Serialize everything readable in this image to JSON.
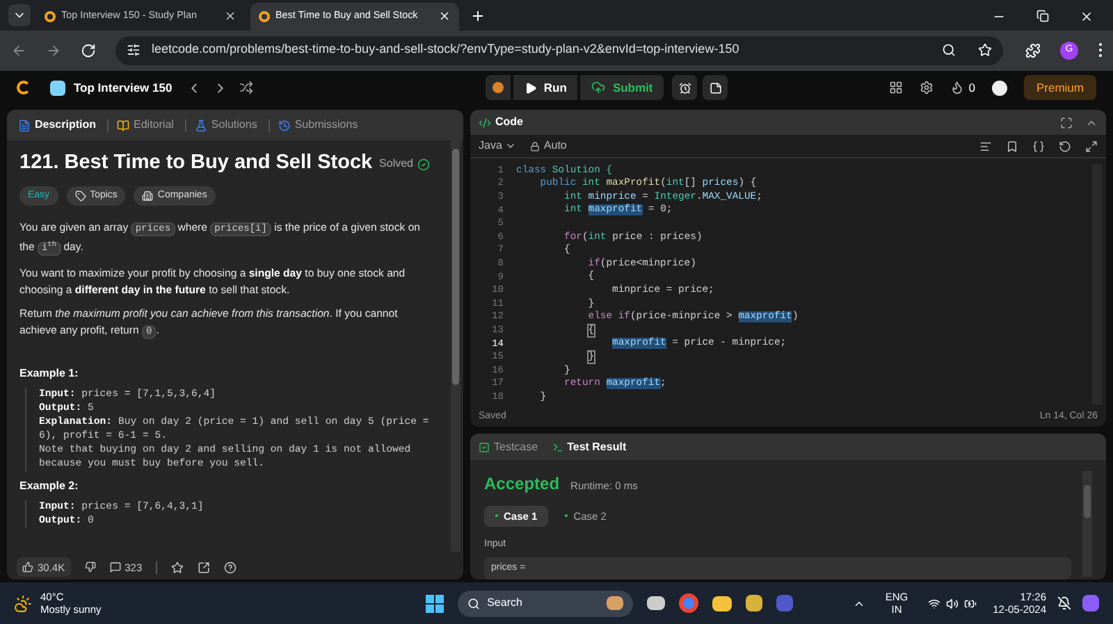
{
  "browser": {
    "tabs": [
      {
        "title": "Top Interview 150 - Study Plan",
        "selected": false
      },
      {
        "title": "Best Time to Buy and Sell Stock",
        "selected": true
      }
    ],
    "url": "leetcode.com/problems/best-time-to-buy-and-sell-stock/?envType=study-plan-v2&envId=top-interview-150",
    "profile": "G"
  },
  "navbar": {
    "study_plan": "Top Interview 150",
    "run": "Run",
    "submit": "Submit",
    "streak": "0",
    "premium": "Premium"
  },
  "description_panel": {
    "tabs": [
      {
        "label": "Description",
        "selected": true
      },
      {
        "label": "Editorial",
        "selected": false
      },
      {
        "label": "Solutions",
        "selected": false
      },
      {
        "label": "Submissions",
        "selected": false
      }
    ],
    "title": "121. Best Time to Buy and Sell Stock",
    "status": "Solved",
    "tags": [
      {
        "label": "Easy",
        "kind": "difficulty"
      },
      {
        "label": "Topics",
        "kind": "topics"
      },
      {
        "label": "Companies",
        "kind": "companies"
      }
    ],
    "paragraphs": [
      [
        {
          "text": "You are given an array ",
          "kind": "text"
        },
        {
          "text": "prices",
          "kind": "code"
        },
        {
          "text": " where ",
          "kind": "text"
        },
        {
          "text": "prices[i]",
          "kind": "code"
        },
        {
          "text": " is the price of a given stock on the ",
          "kind": "text"
        },
        {
          "text": "i$^{th}$",
          "kind": "code"
        },
        {
          "text": " day.",
          "kind": "text"
        }
      ],
      [
        {
          "text": "You want to maximize your profit by choosing a ",
          "kind": "text"
        },
        {
          "text": "single day",
          "kind": "bold"
        },
        {
          "text": " to buy one stock and choosing a ",
          "kind": "text"
        },
        {
          "text": "different day in the future",
          "kind": "bold"
        },
        {
          "text": " to sell that stock.",
          "kind": "text"
        }
      ],
      [
        {
          "text": "Return ",
          "kind": "text"
        },
        {
          "text": "the maximum profit you can achieve from this transaction",
          "kind": "italic"
        },
        {
          "text": ". If you cannot achieve any profit, return ",
          "kind": "text"
        },
        {
          "text": "0",
          "kind": "code"
        },
        {
          "text": ".",
          "kind": "text"
        }
      ]
    ],
    "examples": [
      {
        "title": "Example 1:",
        "lines": [
          {
            "label": "Input:",
            "text": "prices = [7,1,5,3,6,4]"
          },
          {
            "label": "Output:",
            "text": "5"
          },
          {
            "label": "Explanation:",
            "text": "Buy on day 2 (price = 1) and sell on day 5 (price = 6), profit = 6-1 = 5."
          },
          {
            "text": "Note that buying on day 2 and selling on day 1 is not allowed because you must buy before you sell."
          }
        ]
      },
      {
        "title": "Example 2:",
        "lines": [
          {
            "label": "Input:",
            "text": "prices = [7,6,4,3,1]"
          },
          {
            "label": "Output:",
            "text": "0"
          }
        ]
      }
    ],
    "likes": "30.4K",
    "comments": "323"
  },
  "code_panel": {
    "title": "Code",
    "language": "Java",
    "mode": "Auto",
    "lines": [
      {
        "number": "1",
        "current": false,
        "tokens": [
          {
            "text": "class ",
            "kind": "keyword"
          },
          {
            "text": "Solution {",
            "kind": "class"
          }
        ]
      },
      {
        "number": "2",
        "current": false,
        "tokens": [
          {
            "text": "    public ",
            "kind": "keyword"
          },
          {
            "text": "int ",
            "kind": "type"
          },
          {
            "text": "maxProfit",
            "kind": "function"
          },
          {
            "text": "(",
            "kind": "plain"
          },
          {
            "text": "int",
            "kind": "type"
          },
          {
            "text": "[] ",
            "kind": "plain"
          },
          {
            "text": "prices",
            "kind": "variable"
          },
          {
            "text": ") {",
            "kind": "plain"
          }
        ]
      },
      {
        "number": "3",
        "current": false,
        "tokens": [
          {
            "text": "        int ",
            "kind": "type"
          },
          {
            "text": "minprice",
            "kind": "variable"
          },
          {
            "text": " = ",
            "kind": "plain"
          },
          {
            "text": "Integer",
            "kind": "class"
          },
          {
            "text": ".",
            "kind": "plain"
          },
          {
            "text": "MAX_VALUE",
            "kind": "variable"
          },
          {
            "text": ";",
            "kind": "plain"
          }
        ]
      },
      {
        "number": "4",
        "current": false,
        "tokens": [
          {
            "text": "        int ",
            "kind": "type"
          },
          {
            "text": "maxprofit",
            "kind": "highlight"
          },
          {
            "text": " = 0;",
            "kind": "plain"
          }
        ]
      },
      {
        "number": "5",
        "current": false
      },
      {
        "number": "6",
        "current": false,
        "tokens": [
          {
            "text": "        for",
            "kind": "control"
          },
          {
            "text": "(",
            "kind": "plain"
          },
          {
            "text": "int ",
            "kind": "type"
          },
          {
            "text": "price : prices)",
            "kind": "plain"
          }
        ]
      },
      {
        "number": "7",
        "current": false,
        "tokens": [
          {
            "text": "        {",
            "kind": "plain"
          }
        ]
      },
      {
        "number": "8",
        "current": false,
        "tokens": [
          {
            "text": "            if",
            "kind": "control"
          },
          {
            "text": "(price<minprice)",
            "kind": "plain"
          }
        ]
      },
      {
        "number": "9",
        "current": false,
        "tokens": [
          {
            "text": "            {",
            "kind": "plain"
          }
        ]
      },
      {
        "number": "10",
        "current": false,
        "tokens": [
          {
            "text": "                minprice = price;",
            "kind": "plain"
          }
        ]
      },
      {
        "number": "11",
        "current": false,
        "tokens": [
          {
            "text": "            }",
            "kind": "plain"
          }
        ]
      },
      {
        "number": "12",
        "current": false,
        "tokens": [
          {
            "text": "            else if",
            "kind": "control"
          },
          {
            "text": "(price-minprice > ",
            "kind": "plain"
          },
          {
            "text": "maxprofit",
            "kind": "highlight"
          },
          {
            "text": ")",
            "kind": "plain"
          }
        ]
      },
      {
        "number": "13",
        "current": false,
        "tokens": [
          {
            "text": "            {",
            "kind": "match"
          }
        ]
      },
      {
        "number": "14",
        "current": true,
        "tokens": [
          {
            "text": "                maxprofit",
            "kind": "highlight"
          },
          {
            "text": " = price - minprice;",
            "kind": "plain"
          }
        ]
      },
      {
        "number": "15",
        "current": false,
        "tokens": [
          {
            "text": "            }",
            "kind": "match"
          }
        ]
      },
      {
        "number": "16",
        "current": false,
        "tokens": [
          {
            "text": "        }",
            "kind": "plain"
          }
        ]
      },
      {
        "number": "17",
        "current": false,
        "tokens": [
          {
            "text": "        return ",
            "kind": "control"
          },
          {
            "text": "maxprofit",
            "kind": "highlight"
          },
          {
            "text": ";",
            "kind": "plain"
          }
        ]
      },
      {
        "number": "18",
        "current": false,
        "tokens": [
          {
            "text": "    }",
            "kind": "plain"
          }
        ]
      }
    ],
    "save_status": "Saved",
    "cursor": "Ln 14, Col 26"
  },
  "result_panel": {
    "tabs": [
      {
        "label": "Testcase",
        "selected": false
      },
      {
        "label": "Test Result",
        "selected": true
      }
    ],
    "verdict": "Accepted",
    "runtime": "Runtime: 0 ms",
    "cases": [
      {
        "label": "Case 1",
        "selected": true
      },
      {
        "label": "Case 2",
        "selected": false
      }
    ],
    "input_label": "Input",
    "input_value": "prices ="
  },
  "taskbar": {
    "temperature": "40°C",
    "weather": "Mostly sunny",
    "search": "Search",
    "language": "ENG",
    "region": "IN",
    "time": "17:26",
    "date": "12-05-2024"
  }
}
